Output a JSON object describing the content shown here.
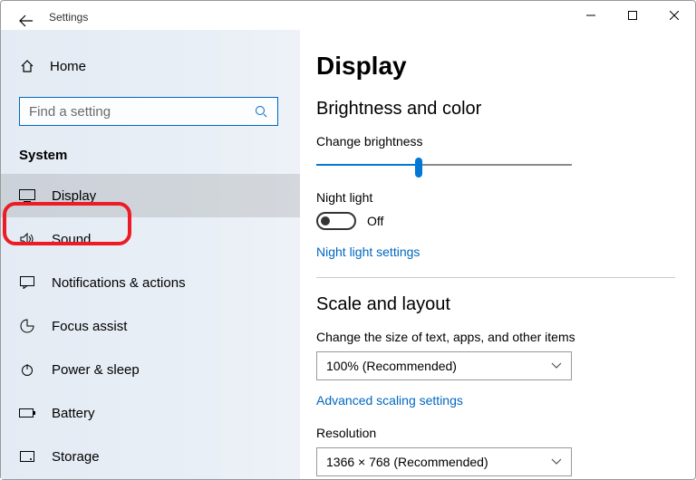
{
  "titlebar": {
    "app_name": "Settings"
  },
  "sidebar": {
    "home_label": "Home",
    "search_placeholder": "Find a setting",
    "category": "System",
    "items": [
      {
        "label": "Display",
        "selected": true
      },
      {
        "label": "Sound"
      },
      {
        "label": "Notifications & actions"
      },
      {
        "label": "Focus assist"
      },
      {
        "label": "Power & sleep"
      },
      {
        "label": "Battery"
      },
      {
        "label": "Storage"
      }
    ]
  },
  "main": {
    "page_title": "Display",
    "brightness_section": {
      "heading": "Brightness and color",
      "slider_label": "Change brightness",
      "slider_value_pct": 40,
      "night_light_label": "Night light",
      "night_light_state": "Off",
      "night_light_link": "Night light settings"
    },
    "scale_section": {
      "heading": "Scale and layout",
      "scale_label": "Change the size of text, apps, and other items",
      "scale_value": "100% (Recommended)",
      "scaling_link": "Advanced scaling settings",
      "resolution_label": "Resolution",
      "resolution_value": "1366 × 768 (Recommended)"
    }
  },
  "colors": {
    "accent": "#0078d4",
    "link": "#0067c0",
    "highlight_ring": "#ed1c24"
  }
}
